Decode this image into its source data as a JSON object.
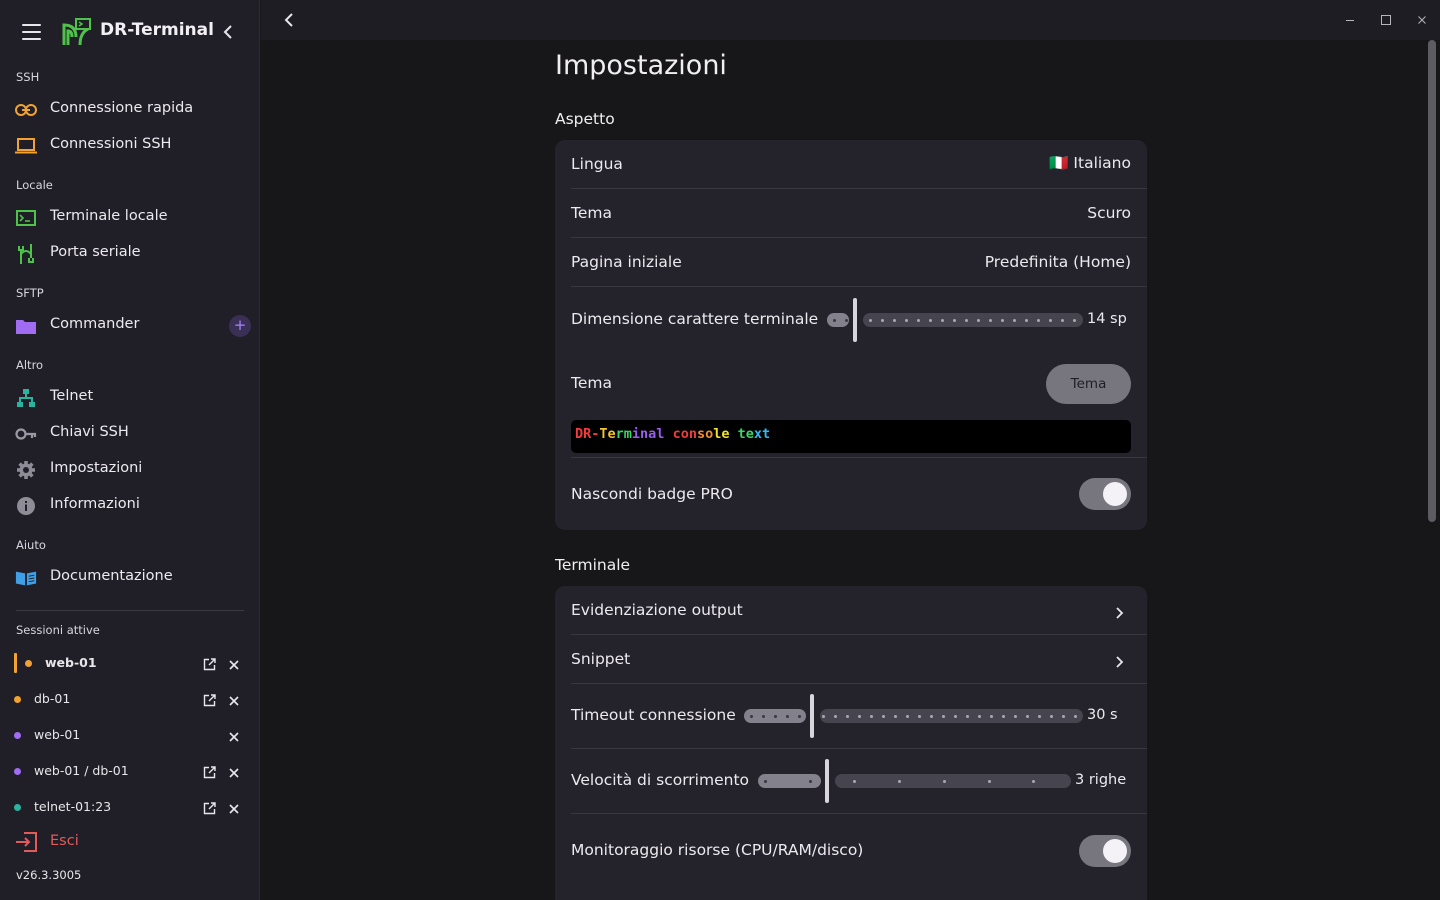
{
  "app": {
    "title": "DR-Terminal",
    "version": "v26.3.3005"
  },
  "colors": {
    "accent": "#a883ff",
    "active_bar": "#f2a230",
    "danger": "#e25a5a"
  },
  "sidebar": {
    "sections": [
      {
        "label": "SSH",
        "items": [
          {
            "label": "Connessione rapida",
            "icon": "link-icon"
          },
          {
            "label": "Connessioni SSH",
            "icon": "laptop-icon"
          }
        ]
      },
      {
        "label": "Locale",
        "items": [
          {
            "label": "Terminale locale",
            "icon": "terminal-icon"
          },
          {
            "label": "Porta seriale",
            "icon": "serial-icon"
          }
        ]
      },
      {
        "label": "SFTP",
        "items": [
          {
            "label": "Commander",
            "icon": "folder-icon",
            "action": "+"
          }
        ]
      },
      {
        "label": "Altro",
        "items": [
          {
            "label": "Telnet",
            "icon": "network-icon"
          },
          {
            "label": "Chiavi SSH",
            "icon": "key-icon"
          },
          {
            "label": "Impostazioni",
            "icon": "gear-icon"
          },
          {
            "label": "Informazioni",
            "icon": "info-icon"
          }
        ]
      },
      {
        "label": "Aiuto",
        "items": [
          {
            "label": "Documentazione",
            "icon": "book-icon"
          }
        ]
      }
    ],
    "sessions_label": "Sessioni attive",
    "sessions": [
      {
        "name": "web-01",
        "color": "#f2a230",
        "active": true,
        "external": true
      },
      {
        "name": "db-01",
        "color": "#f2a230",
        "active": false,
        "external": true
      },
      {
        "name": "web-01",
        "color": "#a06cf2",
        "active": false,
        "external": false
      },
      {
        "name": "web-01 / db-01",
        "color": "#a06cf2",
        "active": false,
        "external": true
      },
      {
        "name": "telnet-01:23",
        "color": "#2bb3a0",
        "active": false,
        "external": true
      }
    ],
    "exit_label": "Esci"
  },
  "page": {
    "title": "Impostazioni",
    "appearance": {
      "title": "Aspetto",
      "language": {
        "label": "Lingua",
        "flag": "🇮🇹",
        "value": "Italiano"
      },
      "theme": {
        "label": "Tema",
        "value": "Scuro"
      },
      "start_page": {
        "label": "Pagina iniziale",
        "value": "Predefinita (Home)"
      },
      "font_size": {
        "label": "Dimensione carattere terminale",
        "value": "14 sp",
        "level": 0.11
      },
      "terminal_theme": {
        "label": "Tema",
        "button": "Tema"
      },
      "preview": [
        {
          "t": "DR-",
          "c": "#f23b3b"
        },
        {
          "t": "Te",
          "c": "#f2c232"
        },
        {
          "t": "rm",
          "c": "#3bd46a"
        },
        {
          "t": "inal",
          "c": "#9b5cf2"
        },
        {
          "t": " ",
          "c": "#ffffff"
        },
        {
          "t": "con",
          "c": "#f23b3b"
        },
        {
          "t": "so",
          "c": "#f28b32"
        },
        {
          "t": "le",
          "c": "#f2e232"
        },
        {
          "t": " ",
          "c": "#ffffff"
        },
        {
          "t": "te",
          "c": "#3bd46a"
        },
        {
          "t": "xt",
          "c": "#32b8f2"
        }
      ],
      "hide_pro": {
        "label": "Nascondi badge PRO",
        "on": true
      }
    },
    "terminal": {
      "title": "Terminale",
      "output_highlight": {
        "label": "Evidenziazione output"
      },
      "snippet": {
        "label": "Snippet"
      },
      "timeout": {
        "label": "Timeout connessione",
        "value": "30 s",
        "level": 0.2
      },
      "scroll_speed": {
        "label": "Velocità di scorrimento",
        "value": "3 righe",
        "level": 0.22
      },
      "monitoring": {
        "label": "Monitoraggio risorse (CPU/RAM/disco)",
        "on": true
      }
    }
  }
}
